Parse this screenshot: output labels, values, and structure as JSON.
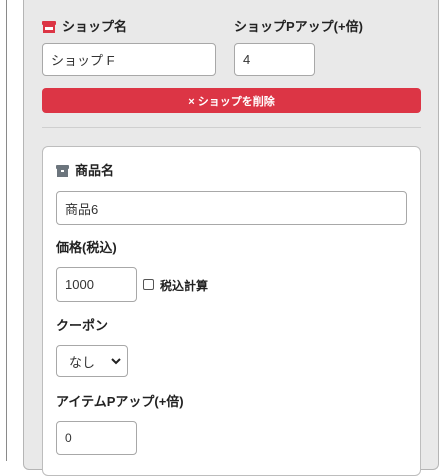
{
  "shop": {
    "name_label": "ショップ名",
    "name_value": "ショップ F",
    "points_label": "ショップPアップ(+倍)",
    "points_value": "4",
    "delete_button": "× ショップを削除"
  },
  "item": {
    "name_label": "商品名",
    "name_value": "商品6",
    "price_label": "価格(税込)",
    "price_value": "1000",
    "tax_calc_label": "税込計算",
    "tax_calc_checked": false,
    "coupon_label": "クーポン",
    "coupon_value": "なし",
    "item_points_label": "アイテムPアップ(+倍)",
    "item_points_value": "0"
  },
  "colors": {
    "danger": "#dc3545",
    "shop_icon": "#dc3545",
    "item_icon": "#6c757d"
  },
  "icons": {
    "shop_icon": "store-icon",
    "item_icon": "box-icon",
    "select_arrow": "chevron-down-icon"
  }
}
